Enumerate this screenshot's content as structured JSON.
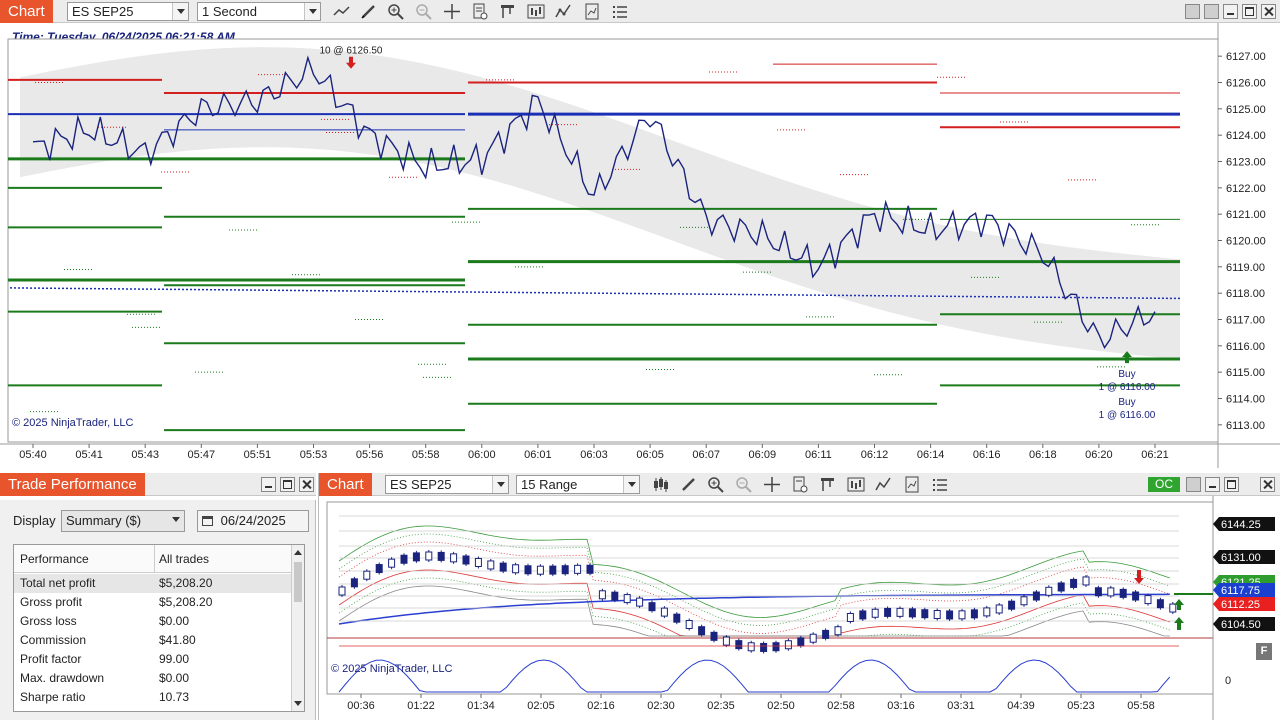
{
  "top_chart": {
    "tab_title": "Chart",
    "instrument": "ES SEP25",
    "interval": "1 Second",
    "time_label": "Time: Tuesday, 06/24/2025 06:21:58 AM",
    "copyright": "© 2025 NinjaTrader, LLC",
    "trade_annotation_top": "10 @ 6126.50",
    "buy_label_1": "Buy",
    "buy_qty_1": "1 @ 6116.00",
    "buy_label_2": "Buy",
    "buy_qty_2": "1 @ 6116.00",
    "price_axis": [
      "6127.00",
      "6126.00",
      "6125.00",
      "6124.00",
      "6123.00",
      "6122.00",
      "6121.00",
      "6120.00",
      "6119.00",
      "6118.00",
      "6117.00",
      "6116.00",
      "6115.00",
      "6114.00",
      "6113.00"
    ],
    "time_axis": [
      "05:40",
      "05:41",
      "05:43",
      "05:47",
      "05:51",
      "05:53",
      "05:56",
      "05:58",
      "06:00",
      "06:01",
      "06:03",
      "06:05",
      "06:07",
      "06:09",
      "06:11",
      "06:12",
      "06:14",
      "06:16",
      "06:18",
      "06:20",
      "06:21"
    ],
    "chart_data": {
      "type": "line",
      "title": "",
      "x_label": "",
      "y_label": "",
      "ylim": [
        6112.5,
        6127.5
      ],
      "x": [
        "05:40",
        "05:41",
        "05:43",
        "05:47",
        "05:51",
        "05:53",
        "05:56",
        "05:58",
        "06:00",
        "06:01",
        "06:03",
        "06:05",
        "06:07",
        "06:09",
        "06:11",
        "06:12",
        "06:14",
        "06:16",
        "06:18",
        "06:20",
        "06:21"
      ],
      "series": [
        {
          "values": [
            6123.5,
            6124.2,
            6123.3,
            6125.0,
            6125.3,
            6126.5,
            6124.0,
            6122.8,
            6123.1,
            6125.3,
            6121.7,
            6124.8,
            6120.8,
            6120.2,
            6119.0,
            6121.0,
            6120.4,
            6120.8,
            6119.5,
            6116.2,
            6117.3
          ]
        }
      ]
    }
  },
  "trade_performance": {
    "title": "Trade Performance",
    "display_label": "Display",
    "display_value": "Summary ($)",
    "date_value": "06/24/2025",
    "col_performance": "Performance",
    "col_all_trades": "All trades",
    "rows": [
      {
        "name": "Total net profit",
        "value": "$5,208.20"
      },
      {
        "name": "Gross profit",
        "value": "$5,208.20"
      },
      {
        "name": "Gross loss",
        "value": "$0.00"
      },
      {
        "name": "Commission",
        "value": "$41.80"
      },
      {
        "name": "Profit factor",
        "value": "99.00"
      },
      {
        "name": "Max. drawdown",
        "value": "$0.00"
      },
      {
        "name": "Sharpe ratio",
        "value": "10.73"
      }
    ]
  },
  "bottom_chart": {
    "tab_title": "Chart",
    "instrument": "ES SEP25",
    "interval": "15 Range",
    "oc_label": "OC",
    "copyright": "© 2025 NinjaTrader, LLC",
    "f_label": "F",
    "price_tags": [
      {
        "text": "6144.25",
        "color": "#111111"
      },
      {
        "text": "6131.00",
        "color": "#111111"
      },
      {
        "text": "6121.25",
        "color": "#2e9d2e"
      },
      {
        "text": "6117.75",
        "color": "#1b3fcf"
      },
      {
        "text": "6112.25",
        "color": "#e8201f"
      },
      {
        "text": "6104.50",
        "color": "#111111"
      }
    ],
    "indicator_axis": "0",
    "time_axis": [
      "00:36",
      "01:22",
      "01:34",
      "02:05",
      "02:16",
      "02:30",
      "02:35",
      "02:50",
      "02:58",
      "03:16",
      "03:31",
      "04:39",
      "05:23",
      "05:58"
    ]
  },
  "colors": {
    "accent": "#e8542b",
    "price_line": "#1a237e",
    "buy_green": "#1b7a1b",
    "sell_red": "#d21f1f",
    "blue_level": "#1b2fb5"
  }
}
